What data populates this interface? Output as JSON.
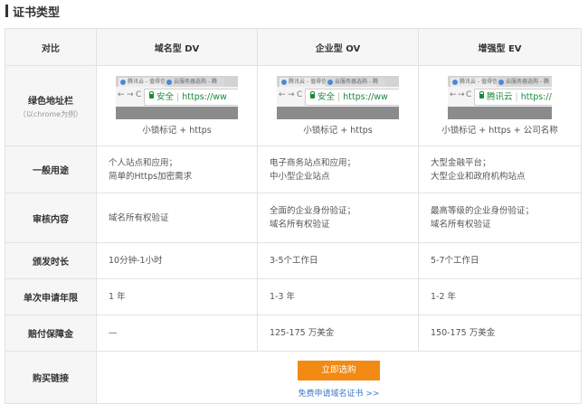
{
  "section_title": "证书类型",
  "headers": [
    "对比",
    "域名型 DV",
    "企业型 OV",
    "增强型 EV"
  ],
  "browser_row": {
    "label": "绿色地址栏",
    "sublabel": "（以chrome为例）",
    "mocks": [
      {
        "tab1": "腾讯云 - 值得信赖",
        "tab2": "云服务器选购 - 腾",
        "secure_text": "安全",
        "url": "https://ww",
        "caption": "小锁标记 + https"
      },
      {
        "tab1": "腾讯云 - 值得信赖",
        "tab2": "云服务器选购 - 腾",
        "secure_text": "安全",
        "url": "https://ww",
        "caption": "小锁标记 + https"
      },
      {
        "tab1": "腾讯云 - 值得信赖",
        "tab2": "云服务器选购 - 腾",
        "secure_text": "腾讯云",
        "url": "https://w",
        "caption": "小锁标记 + https + 公司名称"
      }
    ]
  },
  "rows": [
    {
      "label": "一般用途",
      "values": [
        [
          "个人站点和应用；",
          "简单的Https加密需求"
        ],
        [
          "电子商务站点和应用；",
          "中小型企业站点"
        ],
        [
          "大型金融平台；",
          "大型企业和政府机构站点"
        ]
      ]
    },
    {
      "label": "审核内容",
      "values": [
        [
          "域名所有权验证"
        ],
        [
          "全面的企业身份验证；",
          "域名所有权验证"
        ],
        [
          "最高等级的企业身份验证；",
          "域名所有权验证"
        ]
      ]
    },
    {
      "label": "颁发时长",
      "values": [
        [
          "10分钟-1小时"
        ],
        [
          "3-5个工作日"
        ],
        [
          "5-7个工作日"
        ]
      ]
    },
    {
      "label": "单次申请年限",
      "values": [
        [
          "1 年"
        ],
        [
          "1-3 年"
        ],
        [
          "1-2 年"
        ]
      ]
    },
    {
      "label": "赔付保障金",
      "values": [
        [
          "—"
        ],
        [
          "125-175 万美金"
        ],
        [
          "150-175 万美金"
        ]
      ]
    }
  ],
  "buy_row": {
    "label": "购买链接",
    "button": "立即选购",
    "link": "免费申请域名证书 >>"
  },
  "colors": {
    "accent": "#f28a13",
    "link": "#3a78c9",
    "secure_green": "#1a8a3a",
    "header_bg": "#f6f6f6"
  }
}
